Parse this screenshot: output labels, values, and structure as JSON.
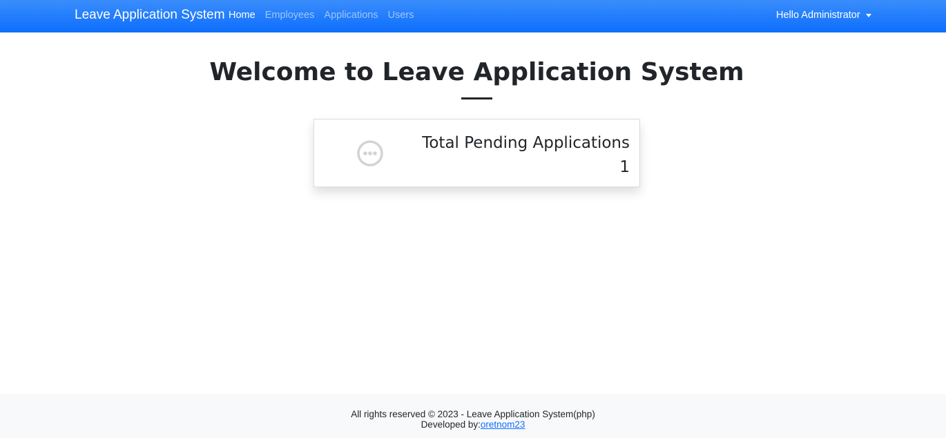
{
  "navbar": {
    "brand": "Leave Application System",
    "links": [
      {
        "label": "Home",
        "active": true
      },
      {
        "label": "Employees",
        "active": false
      },
      {
        "label": "Applications",
        "active": false
      },
      {
        "label": "Users",
        "active": false
      }
    ],
    "user_menu": "Hello Administrator",
    "accent_color": "#0d6efd"
  },
  "main": {
    "title": "Welcome to Leave Application System",
    "card": {
      "icon": "ellipsis-circle-icon",
      "label": "Total Pending Applications",
      "value": "1"
    }
  },
  "footer": {
    "line1": "All rights reserved © 2023 - Leave Application System(php)",
    "line2_prefix": "Developed by:",
    "author_link": "oretnom23"
  }
}
